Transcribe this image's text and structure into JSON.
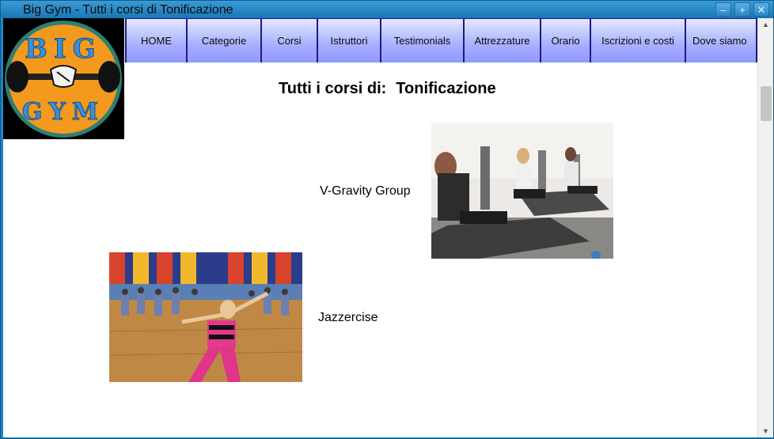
{
  "window": {
    "title": "Big Gym - Tutti i corsi di Tonificazione",
    "controls": {
      "minimize": "–",
      "maximize": "+",
      "close": "✕"
    }
  },
  "logo": {
    "top_text": "BIG",
    "bottom_text": "GYM",
    "colors": {
      "background": "#f39a1e",
      "ring": "#3a8fd8",
      "letters": "#3a8fd8"
    }
  },
  "nav": {
    "items": [
      {
        "label": "HOME"
      },
      {
        "label": "Categorie"
      },
      {
        "label": "Corsi"
      },
      {
        "label": "Istruttori"
      },
      {
        "label": "Testimonials"
      },
      {
        "label": "Attrezzature"
      },
      {
        "label": "Orario"
      },
      {
        "label": "Iscrizioni e costi"
      },
      {
        "label": "Dove siamo"
      }
    ]
  },
  "page": {
    "heading_prefix": "Tutti i corsi di:",
    "heading_category": "Tonificazione",
    "courses": [
      {
        "name": "V-Gravity Group",
        "photo": "pilates-reformer-class-photo"
      },
      {
        "name": "Jazzercise",
        "photo": "aerobics-dance-class-photo"
      }
    ]
  },
  "scrollbar": {
    "up": "▲",
    "down": "▼"
  }
}
